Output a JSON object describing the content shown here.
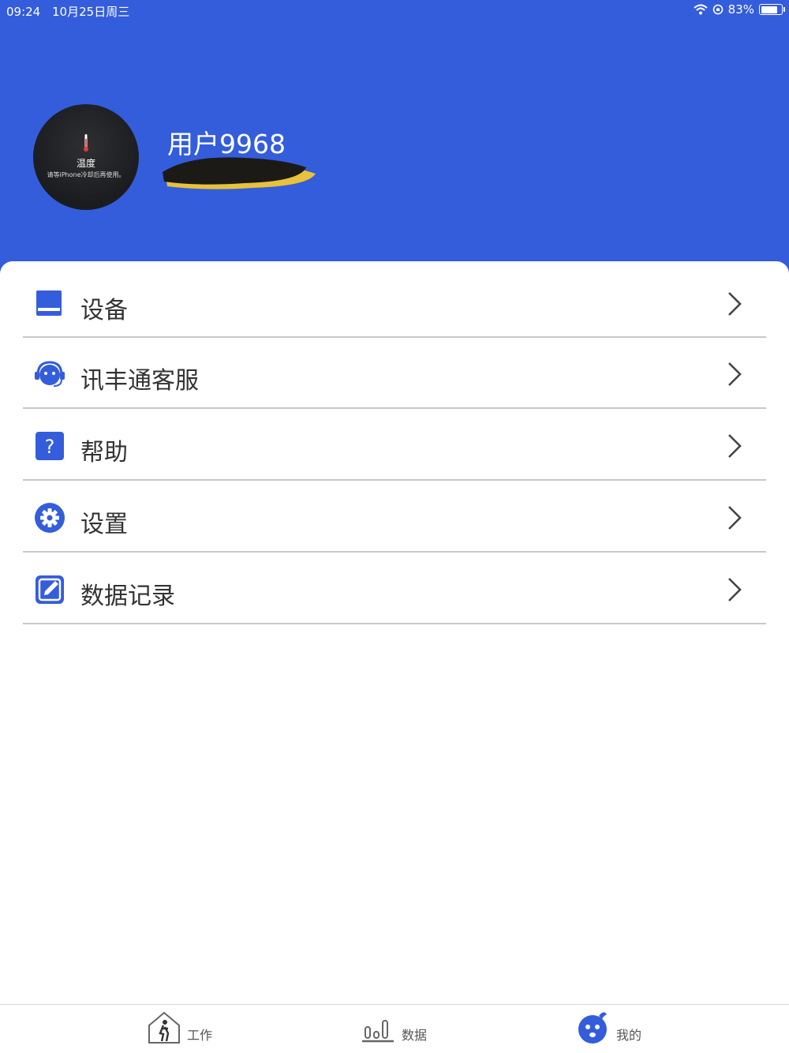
{
  "status_bar": {
    "time": "09:24",
    "date": "10月25日周三",
    "battery": "83%"
  },
  "profile": {
    "avatar_title": "温度",
    "avatar_subtitle": "请等iPhone冷却后再使用。",
    "username": "用户9968"
  },
  "menu": [
    {
      "label": "设备",
      "icon": "device-icon"
    },
    {
      "label": "讯丰通客服",
      "icon": "customer-service-icon"
    },
    {
      "label": "帮助",
      "icon": "help-icon"
    },
    {
      "label": "设置",
      "icon": "settings-gear-icon"
    },
    {
      "label": "数据记录",
      "icon": "edit-record-icon"
    }
  ],
  "tabs": [
    {
      "label": "工作",
      "icon": "work-house-icon"
    },
    {
      "label": "数据",
      "icon": "data-chart-icon"
    },
    {
      "label": "我的",
      "icon": "profile-face-icon"
    }
  ],
  "colors": {
    "brand_blue": "#345ddc",
    "divider": "#c8c8c8"
  }
}
